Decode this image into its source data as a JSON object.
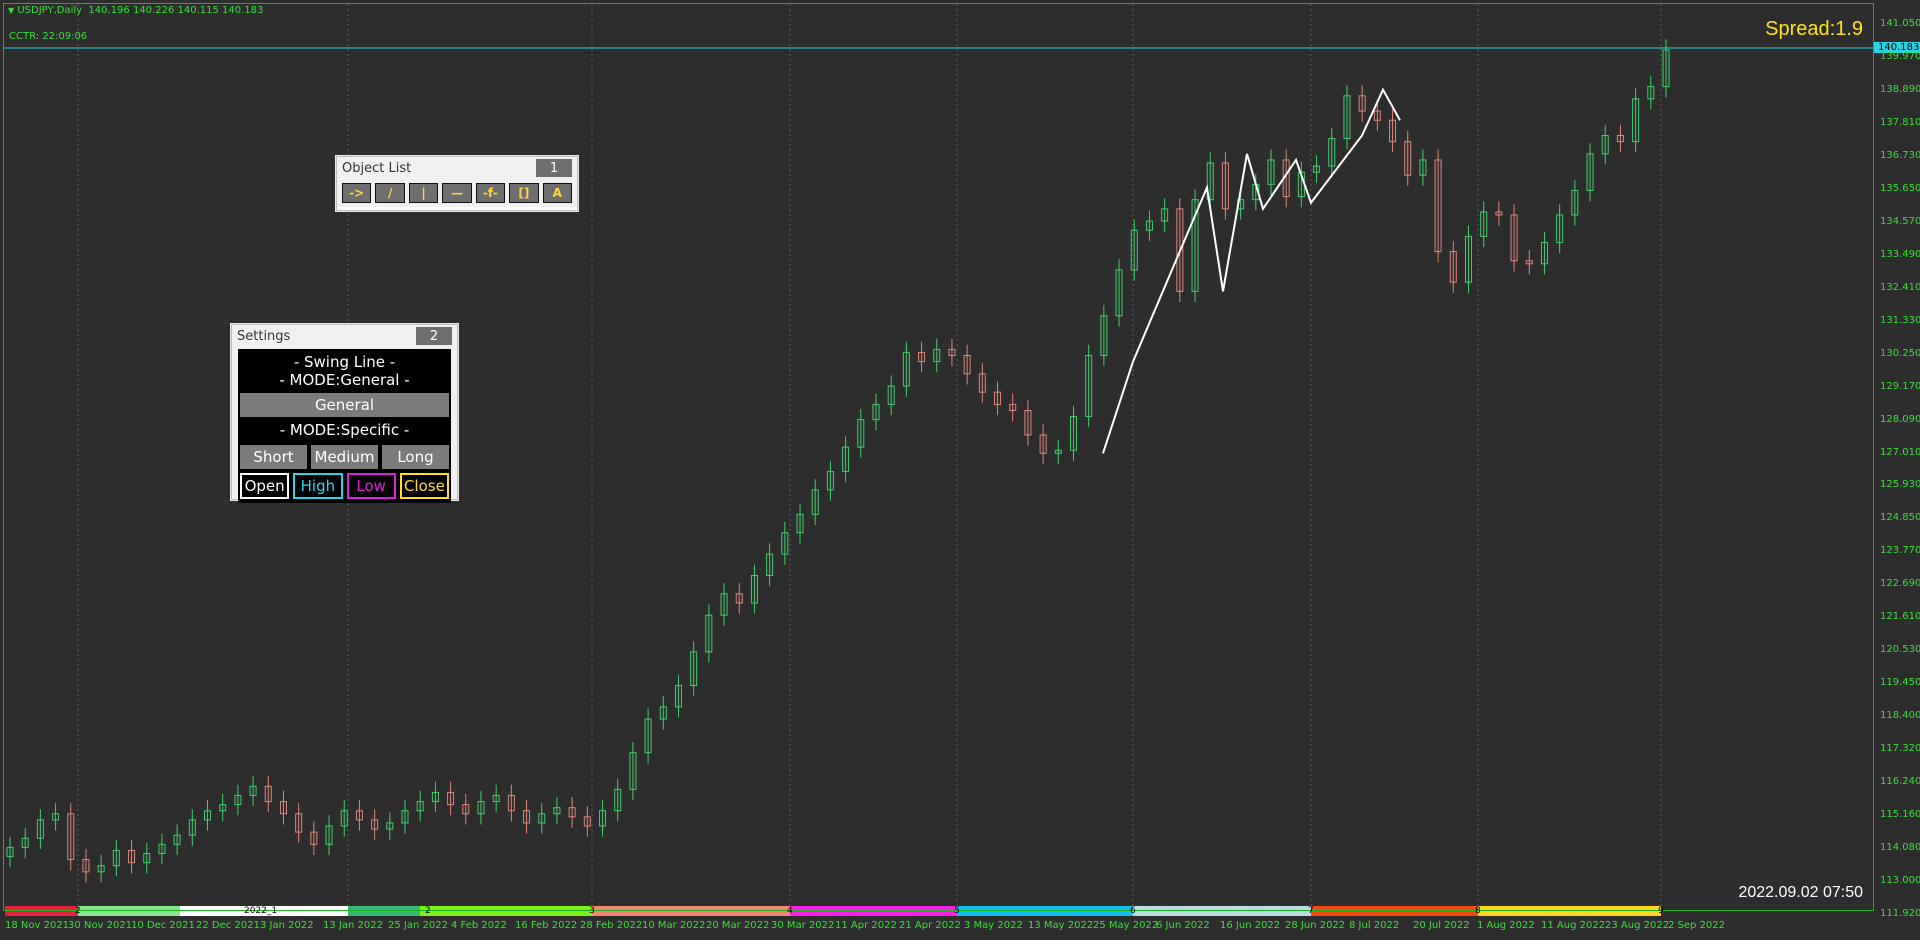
{
  "symbol": {
    "name": "USDJPY,Daily",
    "ohlc": "140.196 140.226 140.115 140.183",
    "cctr": "CCTR: 22:09:06"
  },
  "spread": "Spread:1.9",
  "datetime": "2022.09.02 07:50",
  "current_price": "140.183",
  "price_axis": [
    "141.050",
    "139.970",
    "138.890",
    "137.810",
    "136.730",
    "135.650",
    "134.570",
    "133.490",
    "132.410",
    "131.330",
    "130.250",
    "129.170",
    "128.090",
    "127.010",
    "125.930",
    "124.850",
    "123.770",
    "122.690",
    "121.610",
    "120.530",
    "119.450",
    "118.400",
    "117.320",
    "116.240",
    "115.160",
    "114.080",
    "113.000",
    "111.920"
  ],
  "date_axis": [
    "18 Nov 2021",
    "30 Nov 2021",
    "10 Dec 2021",
    "22 Dec 2021",
    "3 Jan 2022",
    "13 Jan 2022",
    "25 Jan 2022",
    "4 Feb 2022",
    "16 Feb 2022",
    "28 Feb 2022",
    "10 Mar 2022",
    "20 Mar 2022",
    "30 Mar 2022",
    "11 Apr 2022",
    "21 Apr 2022",
    "3 May 2022",
    "13 May 2022",
    "25 May 2022",
    "6 Jun 2022",
    "16 Jun 2022",
    "28 Jun 2022",
    "8 Jul 2022",
    "20 Jul 2022",
    "1 Aug 2022",
    "11 Aug 2022",
    "23 Aug 2022",
    "2 Sep 2022"
  ],
  "segment_labels": [
    "2",
    "2022_1",
    "2",
    "3",
    "4",
    "5",
    "6",
    "7",
    "8",
    "9"
  ],
  "colors": {
    "background": "#2d2d2d",
    "bull": "#3fcf6a",
    "bear": "#e0857a",
    "axis_text": "#34e034",
    "spread": "#ffe11a",
    "swing": "#ffffff",
    "segments": [
      "#e8213a",
      "#86e68a",
      "#ffffff",
      "#35b873",
      "#7df21b",
      "#f2876f",
      "#ff1ee8",
      "#0dc0ef",
      "#b9dce2",
      "#f24a12",
      "#ffd51e"
    ]
  },
  "object_list": {
    "title": "Object List",
    "badge": "1",
    "tools": [
      "->",
      "/",
      "|",
      "—",
      "-f-",
      "[]",
      "A"
    ]
  },
  "settings": {
    "title": "Settings",
    "badge": "2",
    "swing_line": "- Swing Line -",
    "mode_general": "- MODE:General -",
    "general_btn": "General",
    "mode_specific": "- MODE:Specific -",
    "short_btn": "Short",
    "medium_btn": "Medium",
    "long_btn": "Long",
    "open_btn": "Open",
    "high_btn": "High",
    "low_btn": "Low",
    "close_btn": "Close",
    "open_color": "#ffffff",
    "high_color": "#29d6e6",
    "low_color": "#e01ee0",
    "close_color": "#ffe11a"
  },
  "chart_data": {
    "type": "candlestick",
    "series_close_path": [
      114.1,
      114.4,
      115.0,
      115.2,
      113.7,
      113.3,
      113.5,
      114.0,
      113.6,
      113.9,
      114.2,
      114.5,
      115.0,
      115.3,
      115.5,
      115.8,
      116.1,
      115.6,
      115.2,
      114.6,
      114.2,
      114.8,
      115.3,
      115.0,
      114.7,
      114.9,
      115.3,
      115.6,
      115.9,
      115.5,
      115.2,
      115.6,
      115.8,
      115.3,
      114.9,
      115.2,
      115.4,
      115.1,
      114.8,
      115.3,
      116.0,
      117.2,
      118.3,
      118.7,
      119.4,
      120.5,
      121.7,
      122.4,
      122.1,
      123.0,
      123.7,
      124.4,
      125.0,
      125.8,
      126.4,
      127.2,
      128.1,
      128.6,
      129.2,
      130.3,
      130.0,
      130.4,
      130.2,
      129.6,
      129.0,
      128.6,
      128.4,
      127.6,
      127.0,
      127.1,
      128.2,
      130.2,
      131.5,
      133.0,
      134.3,
      134.6,
      135.0,
      132.3,
      135.3,
      136.5,
      135.0,
      135.3,
      135.8,
      136.6,
      135.4,
      136.2,
      136.4,
      137.3,
      138.7,
      138.2,
      137.9,
      137.2,
      136.1,
      136.6,
      133.6,
      132.6,
      134.1,
      134.9,
      134.8,
      133.3,
      133.2,
      133.9,
      134.8,
      135.6,
      136.8,
      137.4,
      137.2,
      138.6,
      139.0,
      140.2
    ],
    "swing_points": [
      [
        127.0,
        "25 May 2022"
      ],
      [
        130.0,
        ""
      ],
      [
        135.7,
        ""
      ],
      [
        132.3,
        ""
      ],
      [
        136.8,
        ""
      ],
      [
        135.0,
        ""
      ],
      [
        136.6,
        ""
      ],
      [
        135.2,
        ""
      ],
      [
        137.4,
        ""
      ],
      [
        138.9,
        ""
      ],
      [
        137.9,
        ""
      ]
    ],
    "ylim": [
      111.92,
      141.05
    ]
  }
}
